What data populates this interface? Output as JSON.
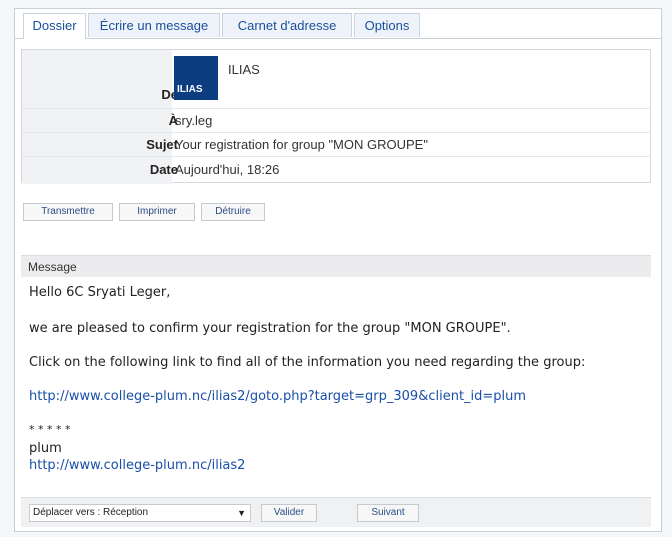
{
  "tabs": [
    {
      "label": "Dossier",
      "active": true
    },
    {
      "label": "Écrire un message",
      "active": false
    },
    {
      "label": "Carnet d'adresse",
      "active": false
    },
    {
      "label": "Options",
      "active": false
    }
  ],
  "header": {
    "from_label": "De",
    "from_name": "ILIAS",
    "logo_text": "ILIAS",
    "to_label": "À",
    "to_value": "sry.leg",
    "subject_label": "Sujet",
    "subject_value": "Your registration for group \"MON GROUPE\"",
    "date_label": "Date",
    "date_value": "Aujourd'hui, 18:26"
  },
  "actions": {
    "forward": "Transmettre",
    "print": "Imprimer",
    "delete": "Détruire"
  },
  "message": {
    "heading": "Message",
    "greeting": "Hello 6C Sryati Leger,",
    "line1": "we are pleased to confirm your registration for the group \"MON GROUPE\".",
    "line2": "Click on the following link to find all of the information you need regarding the group:",
    "link": "http://www.college-plum.nc/ilias2/goto.php?target=grp_309&client_id=plum",
    "separator": "* * * * *",
    "signature": "plum",
    "sig_link": "http://www.college-plum.nc/ilias2"
  },
  "footer": {
    "move_select": "Déplacer vers : Réception",
    "validate": "Valider",
    "next": "Suivant"
  },
  "colors": {
    "tab_text": "#1a4f9c",
    "link": "#1a4fa8",
    "logo_bg": "#0c3d80"
  }
}
